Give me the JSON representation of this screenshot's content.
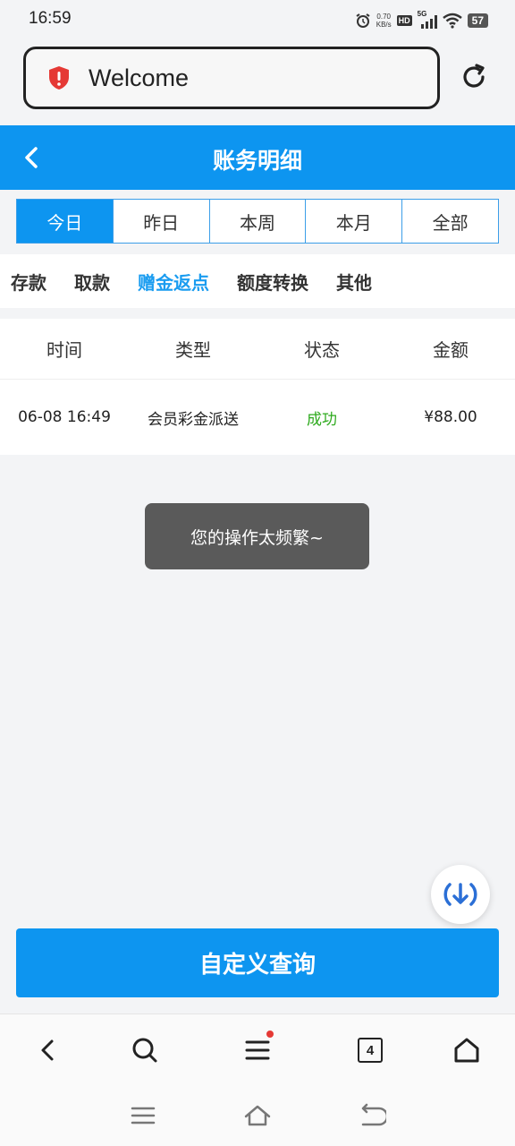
{
  "status_bar": {
    "time": "16:59",
    "net_speed": "0.70",
    "net_unit": "KB/s",
    "hd": "HD",
    "network": "5G",
    "battery": "57"
  },
  "address_bar": {
    "text": "Welcome"
  },
  "header": {
    "title": "账务明细"
  },
  "date_tabs": [
    "今日",
    "昨日",
    "本周",
    "本月",
    "全部"
  ],
  "category_tabs": [
    "存款",
    "取款",
    "赠金返点",
    "额度转换",
    "其他"
  ],
  "table": {
    "headers": [
      "时间",
      "类型",
      "状态",
      "金额"
    ],
    "rows": [
      {
        "time": "06-08 16:49",
        "type": "会员彩金派送",
        "status": "成功",
        "amount": "¥88.00"
      }
    ]
  },
  "toast": {
    "message": "您的操作太频繁~"
  },
  "query_button": {
    "label": "自定义查询"
  },
  "browser_nav": {
    "tab_count": "4"
  },
  "colors": {
    "accent": "#0d95f0",
    "success": "#2eaa1e",
    "active_category": "#1a9cf0"
  }
}
